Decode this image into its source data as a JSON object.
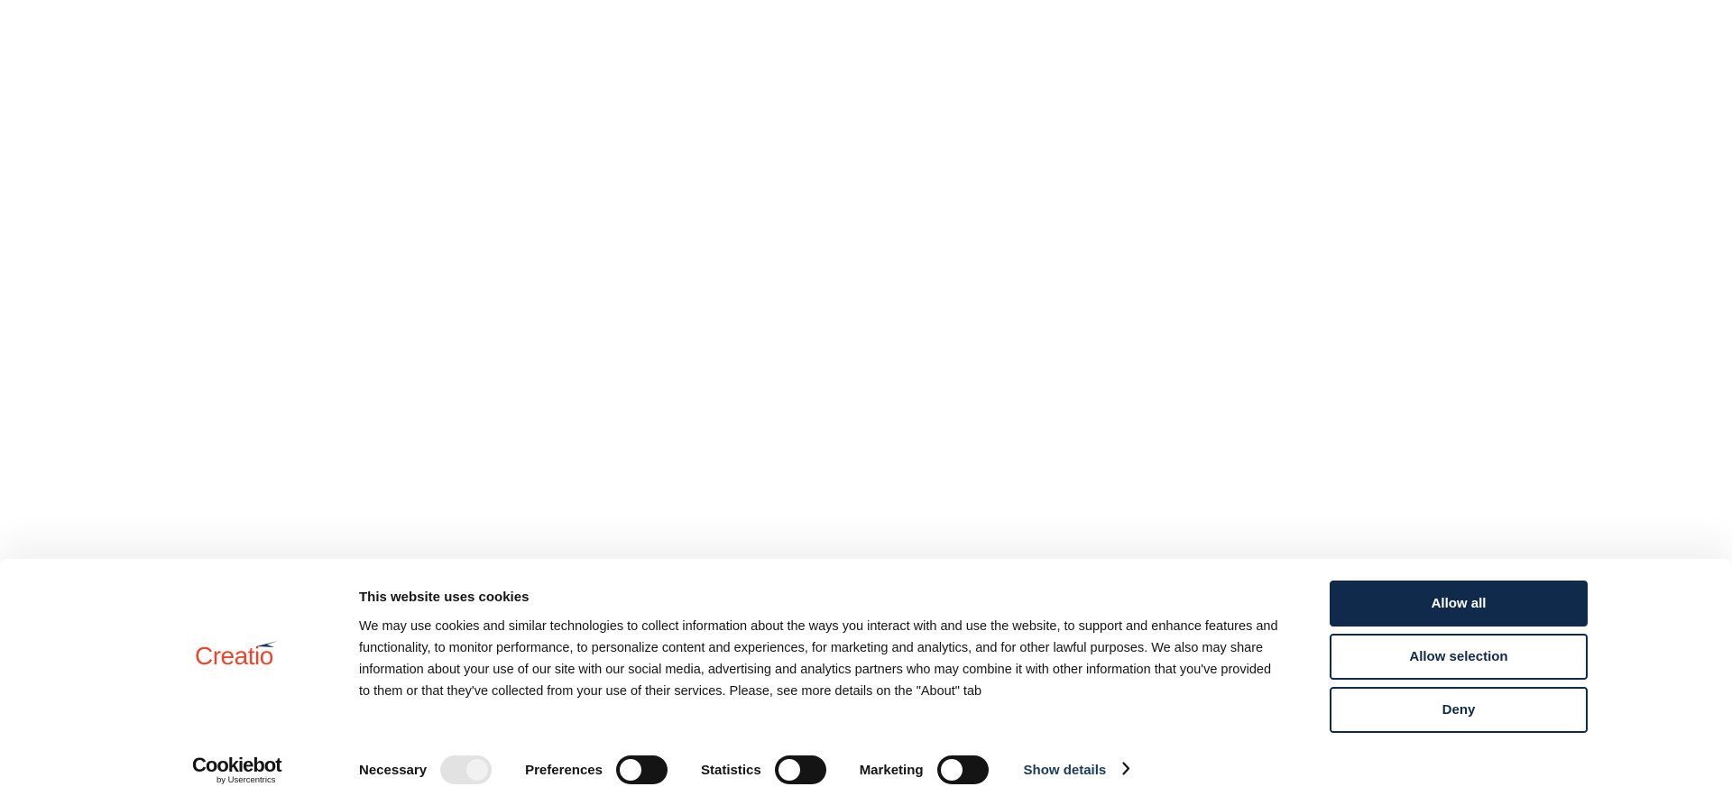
{
  "brand": {
    "logo_text": "Creatio"
  },
  "cookiebot": {
    "name": "Cookiebot",
    "by_line": "by Usercentrics"
  },
  "banner": {
    "title": "This website uses cookies",
    "body": "We may use cookies and similar technologies to collect information about the ways you interact with and use the website, to support and enhance features and functionality, to monitor performance, to personalize content and experiences, for marketing and analytics, and for other lawful purposes. We also may share information about your use of our site with our social media, advertising and analytics partners who may combine it with other information that you've provided to them or that they've collected from your use of their services. Please, see more details on the \"About\" tab"
  },
  "toggles": [
    {
      "label": "Necessary",
      "state": "on",
      "disabled": true
    },
    {
      "label": "Preferences",
      "state": "off",
      "disabled": false
    },
    {
      "label": "Statistics",
      "state": "off",
      "disabled": false
    },
    {
      "label": "Marketing",
      "state": "off",
      "disabled": false
    }
  ],
  "show_details": {
    "label": "Show details",
    "icon": "chevron-right-icon"
  },
  "buttons": {
    "allow_all": "Allow all",
    "allow_selection": "Allow selection",
    "deny": "Deny"
  },
  "colors": {
    "brand_orange": "#e8472f",
    "primary_navy": "#0f2a4a",
    "link_blue": "#1a3a5c",
    "toggle_off": "#141414",
    "toggle_disabled": "#e2e2e2"
  }
}
